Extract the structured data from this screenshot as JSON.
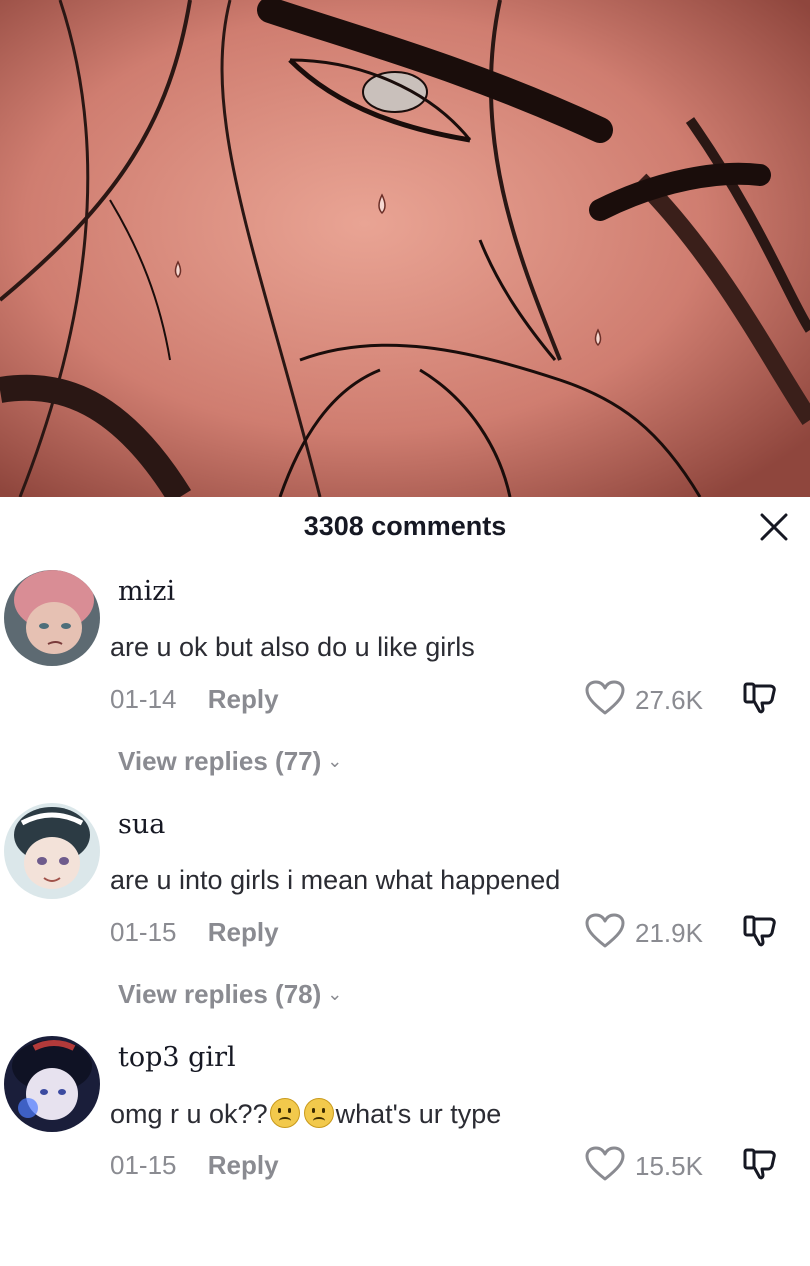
{
  "sheet": {
    "comment_count": "3308 comments",
    "close_icon": "close-icon"
  },
  "comments": [
    {
      "username": "mizi",
      "text": "are u ok but also do u like girls",
      "date": "01-14",
      "reply_label": "Reply",
      "likes": "27.6K",
      "view_replies": "View replies (77)"
    },
    {
      "username": "sua",
      "text": "are u into girls i mean what happened",
      "date": "01-15",
      "reply_label": "Reply",
      "likes": "21.9K",
      "view_replies": "View replies (78)"
    },
    {
      "username": "top3 girl",
      "text_before": "omg r u ok??",
      "emojis": [
        "frowning-face-emoji",
        "frowning-face-emoji"
      ],
      "text_after": "what's ur type",
      "date": "01-15",
      "reply_label": "Reply",
      "likes": "15.5K"
    }
  ],
  "colors": {
    "text_primary": "#161823",
    "text_secondary": "#8a8b91",
    "artwork_skin": "#d98a7d"
  }
}
